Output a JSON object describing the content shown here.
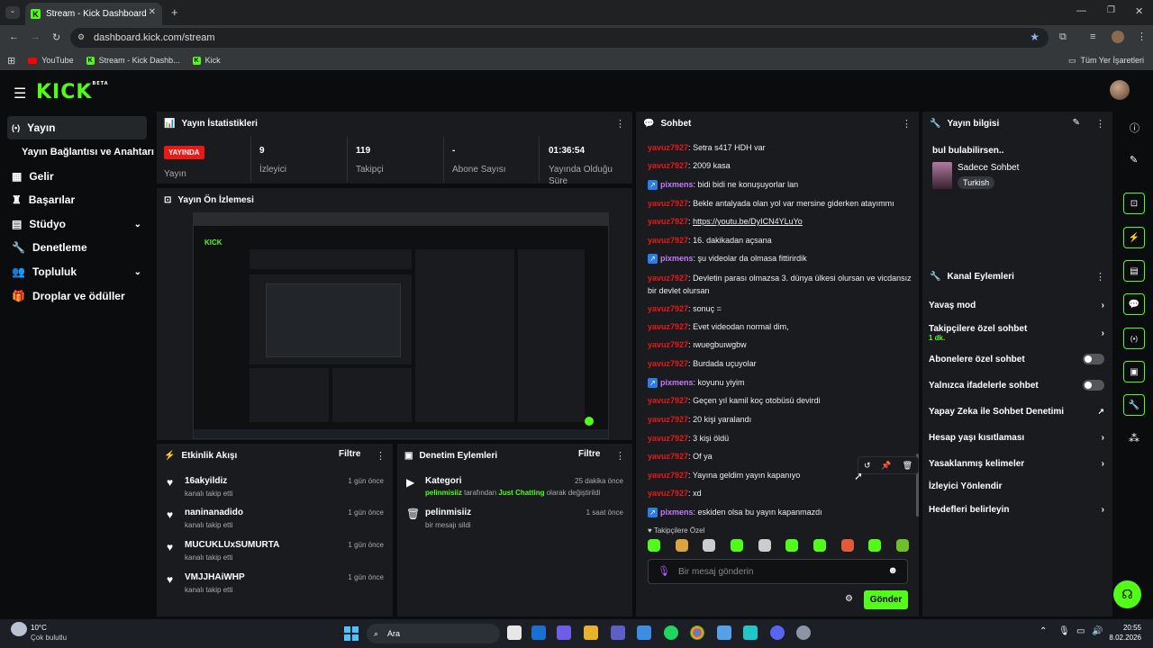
{
  "browser": {
    "tab_title": "Stream - Kick Dashboard",
    "url": "dashboard.kick.com/stream",
    "bookmarks": [
      "YouTube",
      "Stream - Kick Dashb...",
      "Kick"
    ],
    "all_bookmarks": "Tüm Yer İşaretleri"
  },
  "app": {
    "logo": "KICK",
    "beta": "BETA"
  },
  "sidebar": {
    "items": [
      {
        "label": "Yayın"
      },
      {
        "label": "Yayın Bağlantısı ve Anahtarı"
      },
      {
        "label": "Gelir"
      },
      {
        "label": "Başarılar"
      },
      {
        "label": "Stüdyo"
      },
      {
        "label": "Denetleme"
      },
      {
        "label": "Topluluk"
      },
      {
        "label": "Droplar ve ödüller"
      }
    ]
  },
  "stats": {
    "title": "Yayın İstatistikleri",
    "live_badge": "YAYINDA",
    "items": [
      {
        "value": "",
        "label": "Yayın"
      },
      {
        "value": "9",
        "label": "İzleyici"
      },
      {
        "value": "119",
        "label": "Takipçi"
      },
      {
        "value": "-",
        "label": "Abone Sayısı"
      },
      {
        "value": "01:36:54",
        "label": "Yayında Olduğu Süre"
      }
    ]
  },
  "preview": {
    "title": "Yayın Ön İzlemesi"
  },
  "activity": {
    "title": "Etkinlik Akışı",
    "filter": "Filtre",
    "events": [
      {
        "name": "16akyildiz",
        "sub": "kanalı takip etti",
        "time": "1 gün önce"
      },
      {
        "name": "naninanadido",
        "sub": "kanalı takip etti",
        "time": "1 gün önce"
      },
      {
        "name": "MUCUKLUxSUMURTA",
        "sub": "kanalı takip etti",
        "time": "1 gün önce"
      },
      {
        "name": "VMJJHAiWHP",
        "sub": "kanalı takip etti",
        "time": "1 gün önce"
      }
    ]
  },
  "moderation": {
    "title": "Denetim Eylemleri",
    "filter": "Filtre",
    "items": [
      {
        "name": "Kategori",
        "time": "25 dakika önce",
        "user": "pelinmisiiz",
        "mid": " tarafından ",
        "cat": "Just Chatting",
        "tail": " olarak değiştirildi"
      },
      {
        "name": "pelinmisiiz",
        "time": "1 saat önce",
        "sub": "bir mesajı sildi"
      }
    ]
  },
  "chat": {
    "title": "Sohbet",
    "messages": [
      {
        "user": "yavuz7927",
        "text": "Setra s417 HDH var"
      },
      {
        "user": "yavuz7927",
        "text": "2009 kasa"
      },
      {
        "user": "pixmens",
        "text": "bidi bidi ne konuşuyorlar lan",
        "badge": true
      },
      {
        "user": "yavuz7927",
        "text": "Bekle antalyada olan yol var mersine giderken atayımmı"
      },
      {
        "user": "yavuz7927",
        "text": "https://youtu.be/DyICN4YLuYo"
      },
      {
        "user": "yavuz7927",
        "text": "16. dakikadan açsana"
      },
      {
        "user": "pixmens",
        "text": "şu videolar da olmasa fittirirdik",
        "badge": true
      },
      {
        "user": "yavuz7927",
        "text": "Devletin parası olmazsa 3. dünya ülkesi olursan ve vicdansız bir devlet olursan"
      },
      {
        "user": "yavuz7927",
        "text": "sonuç ="
      },
      {
        "user": "yavuz7927",
        "text": "Evet videodan normal dim,"
      },
      {
        "user": "yavuz7927",
        "text": "ıwuegbuıwgbw"
      },
      {
        "user": "yavuz7927",
        "text": "Burdada uçuyolar"
      },
      {
        "user": "pixmens",
        "text": "koyunu yiyim",
        "badge": true
      },
      {
        "user": "yavuz7927",
        "text": "Geçen yıl kamil koç otobüsü devirdi"
      },
      {
        "user": "yavuz7927",
        "text": "20 kişi yaralandı"
      },
      {
        "user": "yavuz7927",
        "text": "3 kişi öldü"
      },
      {
        "user": "yavuz7927",
        "text": "Of ya"
      },
      {
        "user": "yavuz7927",
        "text": "Yayına geldim yayın kapanıyo"
      },
      {
        "user": "yavuz7927",
        "text": "xd"
      },
      {
        "user": "pixmens",
        "text": "eskiden olsa bu yayın kapanmazdı",
        "badge": true
      }
    ],
    "follower_only": "Takipçilere Özel",
    "placeholder": "Bir mesaj gönderin",
    "send": "Gönder"
  },
  "info": {
    "title": "Yayın bilgisi",
    "stream_title": "bul bulabilirsen..",
    "category": "Sadece Sohbet",
    "tag": "Turkish"
  },
  "channel": {
    "title": "Kanal Eylemleri",
    "rows": [
      {
        "label": "Yavaş mod"
      },
      {
        "label": "Takipçilere özel sohbet",
        "sub": "1 dk."
      },
      {
        "label": "Abonelere özel sohbet"
      },
      {
        "label": "Yalnızca ifadelerle sohbet"
      },
      {
        "label": "Yapay Zeka ile Sohbet Denetimi"
      },
      {
        "label": "Hesap yaşı kısıtlaması"
      },
      {
        "label": "Yasaklanmış kelimeler"
      },
      {
        "label": "İzleyici Yönlendir"
      },
      {
        "label": "Hedefleri belirleyin"
      }
    ]
  },
  "taskbar": {
    "weather_temp": "10°C",
    "weather_desc": "Çok bulutlu",
    "search": "Ara",
    "time": "20:55",
    "date": "8.02.2026"
  },
  "colors": {
    "accent": "#53fc18",
    "live": "#e91916",
    "panel": "#191b1f"
  }
}
